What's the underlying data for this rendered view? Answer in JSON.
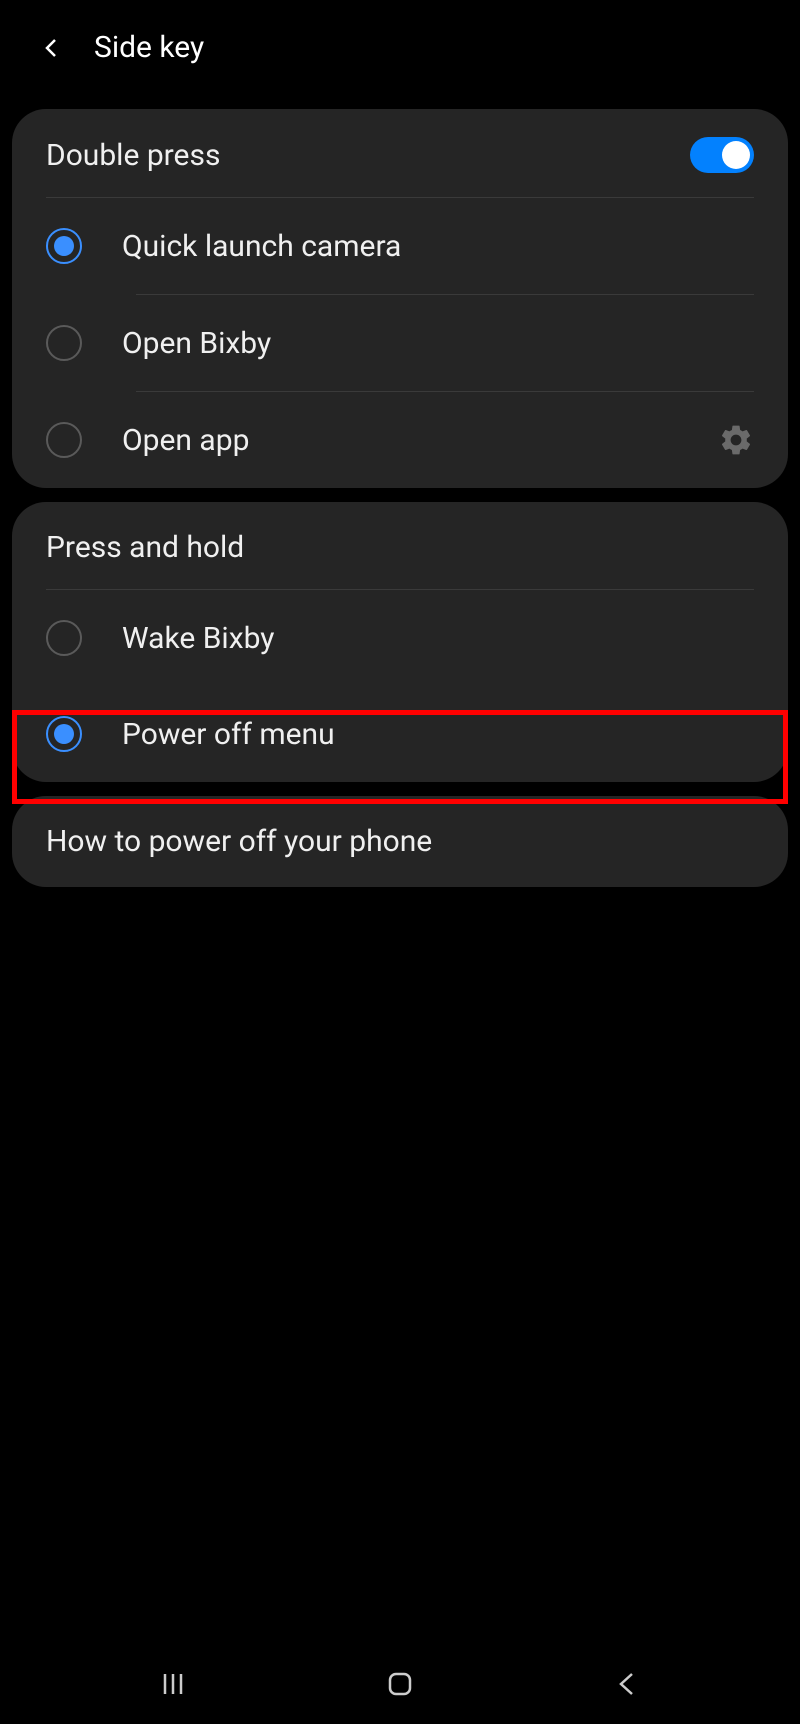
{
  "header": {
    "title": "Side key"
  },
  "sections": {
    "doublePress": {
      "title": "Double press",
      "toggleEnabled": true,
      "options": [
        {
          "label": "Quick launch camera",
          "selected": true
        },
        {
          "label": "Open Bixby",
          "selected": false
        },
        {
          "label": "Open app",
          "selected": false,
          "hasSettings": true
        }
      ]
    },
    "pressHold": {
      "title": "Press and hold",
      "options": [
        {
          "label": "Wake Bixby",
          "selected": false
        },
        {
          "label": "Power off menu",
          "selected": true
        }
      ]
    }
  },
  "infoCard": {
    "text": "How to power off your phone"
  }
}
